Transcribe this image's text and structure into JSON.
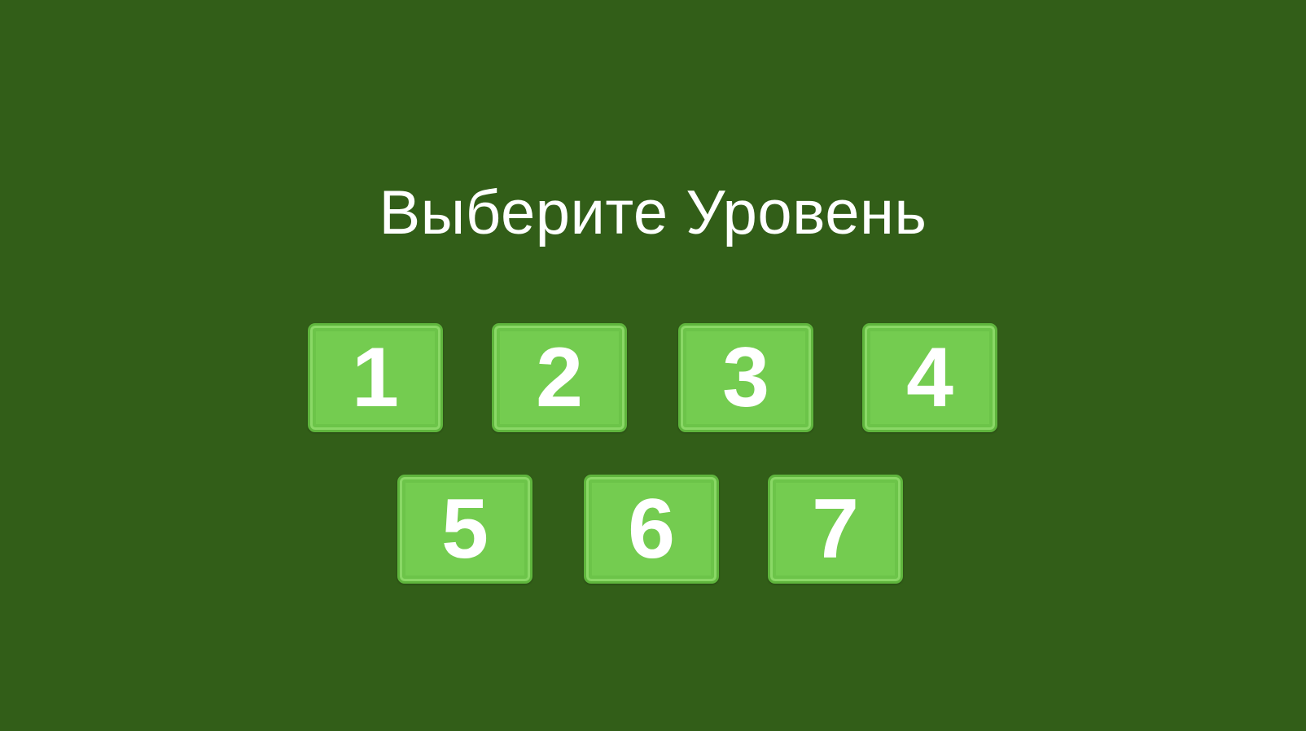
{
  "screen": {
    "title": "Выберите Уровень",
    "colors": {
      "background": "#325e18",
      "button": "#74cc50",
      "button_border": "#5fb53d",
      "text": "#ffffff"
    }
  },
  "levels": [
    {
      "label": "1"
    },
    {
      "label": "2"
    },
    {
      "label": "3"
    },
    {
      "label": "4"
    },
    {
      "label": "5"
    },
    {
      "label": "6"
    },
    {
      "label": "7"
    }
  ]
}
